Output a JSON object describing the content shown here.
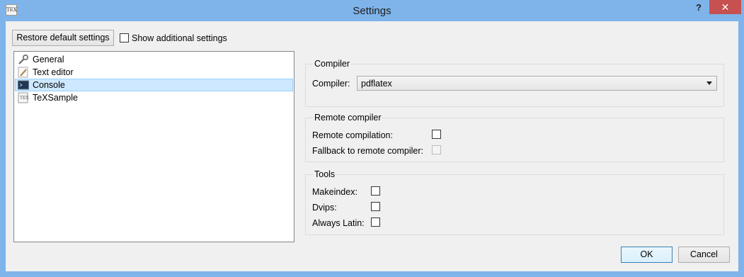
{
  "window": {
    "title": "Settings",
    "help_glyph": "?",
    "close_glyph": "✕",
    "app_icon_text": "TEX"
  },
  "toolbar": {
    "restore_label": "Restore default settings",
    "show_additional_label": "Show additional settings",
    "show_additional_checked": false
  },
  "sidebar": {
    "items": [
      {
        "label": "General",
        "icon": "wrench-icon",
        "selected": false
      },
      {
        "label": "Text editor",
        "icon": "pencil-icon",
        "selected": false
      },
      {
        "label": "Console",
        "icon": "console-icon",
        "selected": true
      },
      {
        "label": "TeXSample",
        "icon": "texsample-icon",
        "selected": false
      }
    ]
  },
  "compiler_group": {
    "title": "Compiler",
    "compiler_label": "Compiler:",
    "compiler_value": "pdflatex"
  },
  "remote_group": {
    "title": "Remote compiler",
    "remote_compilation_label": "Remote compilation:",
    "remote_compilation_checked": false,
    "fallback_label": "Fallback to remote compiler:",
    "fallback_checked": false,
    "fallback_enabled": false
  },
  "tools_group": {
    "title": "Tools",
    "makeindex_label": "Makeindex:",
    "makeindex_checked": false,
    "dvips_label": "Dvips:",
    "dvips_checked": false,
    "always_latin_label": "Always Latin:",
    "always_latin_checked": false
  },
  "buttons": {
    "ok_label": "OK",
    "cancel_label": "Cancel"
  },
  "colors": {
    "titlebar": "#7eb4ea",
    "close": "#c75050",
    "selection": "#cde8ff"
  }
}
